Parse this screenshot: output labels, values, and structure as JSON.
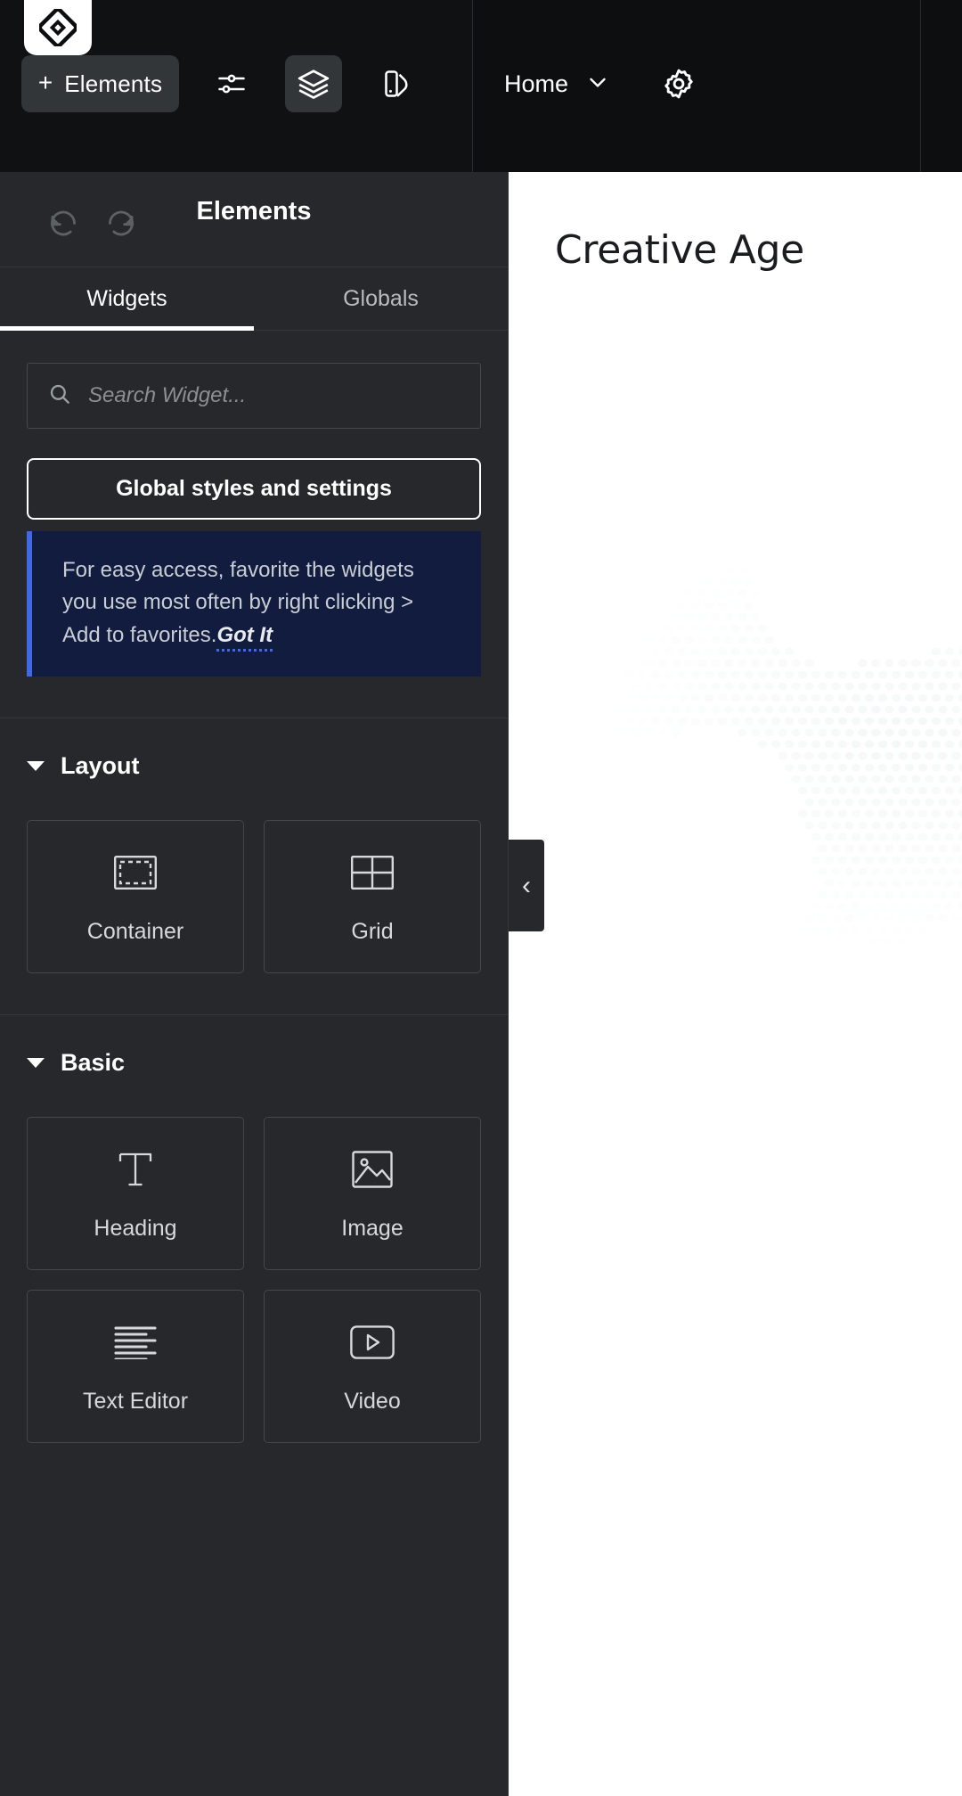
{
  "topbar": {
    "logo_icon": "elementor-logo-icon",
    "elements_button": {
      "label": "Elements",
      "plus": "+",
      "icon": "plus-icon"
    },
    "icons": [
      {
        "name": "settings-sliders-icon",
        "active": false
      },
      {
        "name": "layers-icon",
        "active": true
      },
      {
        "name": "theme-style-icon",
        "active": false
      }
    ],
    "page_selector": {
      "label": "Home",
      "chevron": "chevron-down-icon"
    },
    "gear": {
      "name": "gear-icon"
    }
  },
  "panel": {
    "title": "Elements",
    "history": {
      "undo": "undo-icon",
      "redo": "redo-icon"
    },
    "tabs": [
      {
        "label": "Widgets",
        "active": true
      },
      {
        "label": "Globals",
        "active": false
      }
    ],
    "search": {
      "placeholder": "Search Widget...",
      "value": "",
      "icon": "search-icon"
    },
    "global_button": {
      "label": "Global styles and settings"
    },
    "notice": {
      "text": "For easy access, favorite the widgets you use most often by right clicking > Add to favorites.",
      "action": "Got It",
      "accent": "#4169e1",
      "background": "#111c3f"
    },
    "sections": [
      {
        "name": "Layout",
        "collapsed": false,
        "widgets": [
          {
            "label": "Container",
            "icon": "container-icon"
          },
          {
            "label": "Grid",
            "icon": "grid-icon"
          }
        ]
      },
      {
        "name": "Basic",
        "collapsed": false,
        "widgets": [
          {
            "label": "Heading",
            "icon": "heading-text-icon"
          },
          {
            "label": "Image",
            "icon": "image-icon"
          },
          {
            "label": "Text Editor",
            "icon": "text-editor-icon"
          },
          {
            "label": "Video",
            "icon": "video-play-icon"
          }
        ]
      }
    ]
  },
  "canvas": {
    "heading": "Creative Age",
    "background": "#ffffff",
    "collapse_handle": {
      "icon": "chevron-left-icon"
    }
  }
}
